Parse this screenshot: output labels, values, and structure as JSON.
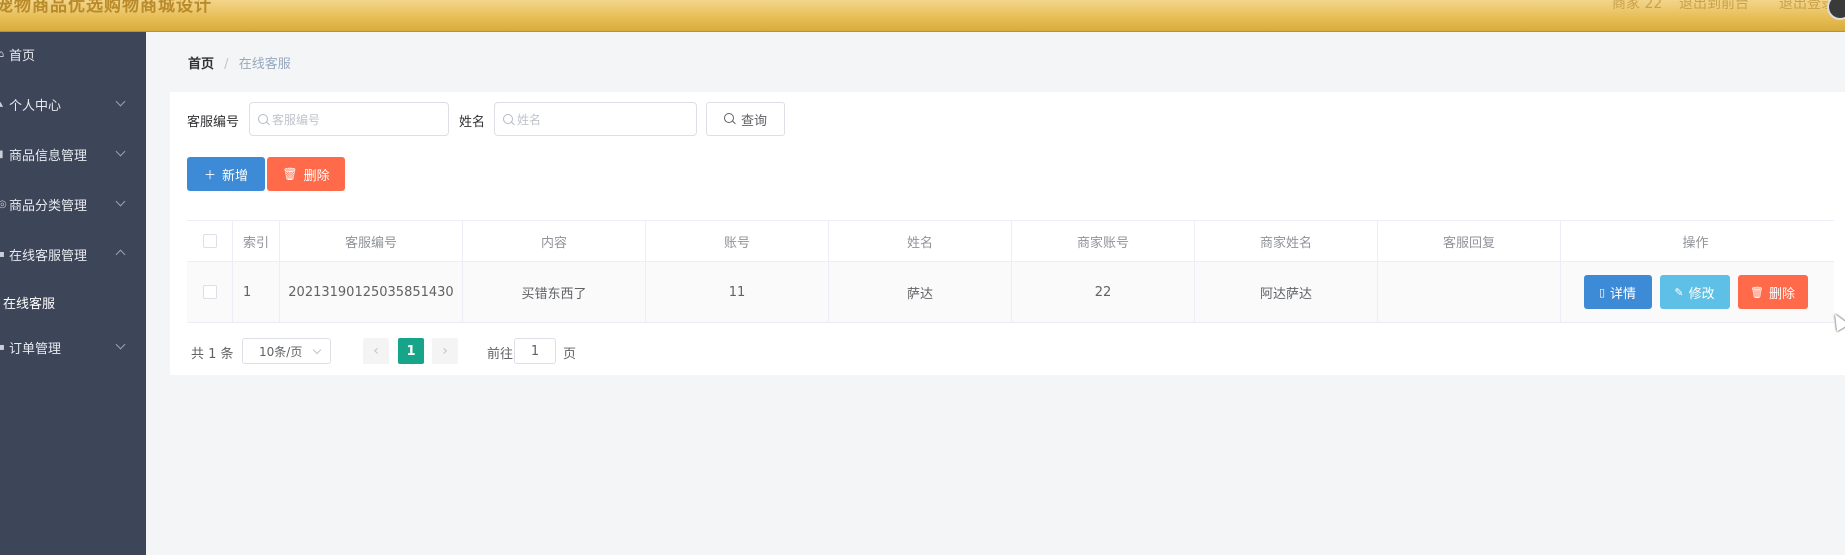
{
  "header": {
    "site_title": "宠物商品优选购物商城设计",
    "user_label": "商家 22",
    "home_link": "退出到前台",
    "logout_link": "退出登录"
  },
  "sidebar": {
    "items": [
      {
        "label": "首页",
        "icon": "home-icon"
      },
      {
        "label": "个人中心",
        "icon": "user-icon"
      },
      {
        "label": "商品信息管理",
        "icon": "list-icon"
      },
      {
        "label": "商品分类管理",
        "icon": "category-icon"
      },
      {
        "label": "在线客服管理",
        "icon": "service-icon"
      },
      {
        "label": "订单管理",
        "icon": "order-icon"
      }
    ],
    "sub_item": "在线客服"
  },
  "breadcrumb": {
    "home": "首页",
    "separator": "/",
    "current": "在线客服"
  },
  "search": {
    "service_no_label": "客服编号",
    "service_no_placeholder": "客服编号",
    "name_label": "姓名",
    "name_placeholder": "姓名",
    "query_label": "查询"
  },
  "actions": {
    "add_label": "新增",
    "delete_label": "删除"
  },
  "table": {
    "columns": [
      "索引",
      "客服编号",
      "内容",
      "账号",
      "姓名",
      "商家账号",
      "商家姓名",
      "客服回复",
      "操作"
    ],
    "rows": [
      {
        "index": "1",
        "service_no": "20213190125035851430",
        "content": "买错东西了",
        "account": "11",
        "name": "萨达",
        "merchant_account": "22",
        "merchant_name": "阿达萨达",
        "reply": ""
      }
    ],
    "row_actions": {
      "detail": "详情",
      "edit": "修改",
      "delete": "删除"
    }
  },
  "pagination": {
    "total": "共 1 条",
    "page_size": "10条/页",
    "current_page": "1",
    "goto_prefix": "前往",
    "goto_value": "1",
    "goto_suffix": "页"
  },
  "colors": {
    "primary": "#3d8ad6",
    "danger": "#ff6b4a",
    "info": "#5ec0e6",
    "page_active": "#17a58a",
    "sidebar_bg": "#3d4558",
    "header_gold": "#e7be57"
  }
}
